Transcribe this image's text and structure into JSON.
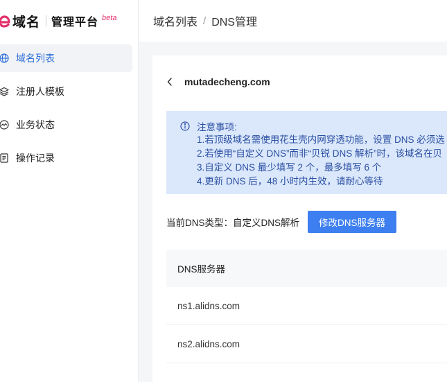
{
  "brand": {
    "name": "域名",
    "subtitle": "管理平台",
    "badge": "beta",
    "logo_color": "#e3306b"
  },
  "sidebar": {
    "items": [
      {
        "label": "域名列表",
        "icon": "globe-icon",
        "active": true
      },
      {
        "label": "注册人模板",
        "icon": "layers-icon",
        "active": false
      },
      {
        "label": "业务状态",
        "icon": "activity-icon",
        "active": false
      },
      {
        "label": "操作记录",
        "icon": "document-icon",
        "active": false
      }
    ]
  },
  "header": {
    "breadcrumb": [
      "域名列表",
      "DNS管理"
    ],
    "separator": "/"
  },
  "main": {
    "domain": "mutadecheng.com",
    "notice": {
      "title": "注意事项:",
      "lines": [
        "1.若顶级域名需使用花生壳内网穿透功能，设置 DNS 必须选",
        "2.若使用“自定义 DNS”而非“贝锐 DNS 解析”时，该域名在贝",
        "3.自定义 DNS 最少填写 2 个，最多填写 6 个",
        "4.更新 DNS 后，48 小时内生效，请耐心等待"
      ]
    },
    "dns_type_label": "当前DNS类型：",
    "dns_type_value": "自定义DNS解析",
    "modify_button": "修改DNS服务器",
    "table": {
      "header": "DNS服务器",
      "rows": [
        "ns1.alidns.com",
        "ns2.alidns.com"
      ]
    }
  },
  "colors": {
    "accent": "#3d7ff0",
    "active_nav_text": "#2f6fdc",
    "notice_bg": "#dbe8fb",
    "notice_text": "#2b4fa3"
  }
}
